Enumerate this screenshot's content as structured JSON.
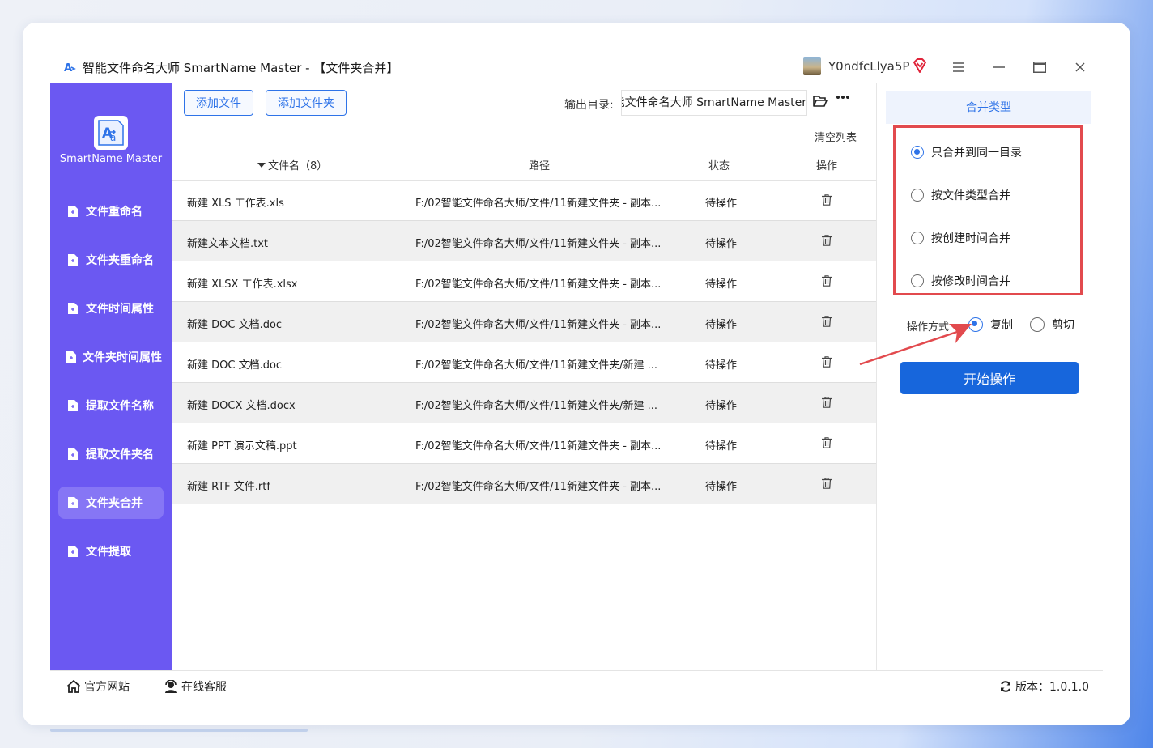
{
  "window": {
    "title": "智能文件命名大师 SmartName Master - 【文件夹合并】",
    "user_name": "Y0ndfcLlya5P"
  },
  "sidebar": {
    "app_name": "SmartName Master",
    "items": [
      {
        "label": "文件重命名",
        "active": false
      },
      {
        "label": "文件夹重命名",
        "active": false
      },
      {
        "label": "文件时间属性",
        "active": false
      },
      {
        "label": "文件夹时间属性",
        "active": false
      },
      {
        "label": "提取文件名称",
        "active": false
      },
      {
        "label": "提取文件夹名",
        "active": false
      },
      {
        "label": "文件夹合并",
        "active": true
      },
      {
        "label": "文件提取",
        "active": false
      }
    ]
  },
  "toolbar": {
    "add_file": "添加文件",
    "add_folder": "添加文件夹",
    "output_label": "输出目录:",
    "output_value": "能文件命名大师 SmartName Master",
    "clear_list": "清空列表"
  },
  "table": {
    "headers": {
      "name": "文件名（8）",
      "path": "路径",
      "status": "状态",
      "action": "操作"
    },
    "rows": [
      {
        "name": "新建 XLS 工作表.xls",
        "path": "F:/02智能文件命名大师/文件/11新建文件夹 - 副本...",
        "status": "待操作"
      },
      {
        "name": "新建文本文档.txt",
        "path": "F:/02智能文件命名大师/文件/11新建文件夹 - 副本...",
        "status": "待操作"
      },
      {
        "name": "新建 XLSX 工作表.xlsx",
        "path": "F:/02智能文件命名大师/文件/11新建文件夹 - 副本...",
        "status": "待操作"
      },
      {
        "name": "新建 DOC 文档.doc",
        "path": "F:/02智能文件命名大师/文件/11新建文件夹 - 副本...",
        "status": "待操作"
      },
      {
        "name": "新建 DOC 文档.doc",
        "path": "F:/02智能文件命名大师/文件/11新建文件夹/新建 ...",
        "status": "待操作"
      },
      {
        "name": "新建 DOCX 文档.docx",
        "path": "F:/02智能文件命名大师/文件/11新建文件夹/新建 ...",
        "status": "待操作"
      },
      {
        "name": "新建 PPT 演示文稿.ppt",
        "path": "F:/02智能文件命名大师/文件/11新建文件夹 - 副本...",
        "status": "待操作"
      },
      {
        "name": "新建 RTF 文件.rtf",
        "path": "F:/02智能文件命名大师/文件/11新建文件夹 - 副本...",
        "status": "待操作"
      }
    ]
  },
  "merge_panel": {
    "header": "合并类型",
    "options": [
      {
        "label": "只合并到同一目录",
        "selected": true
      },
      {
        "label": "按文件类型合并",
        "selected": false
      },
      {
        "label": "按创建时间合并",
        "selected": false
      },
      {
        "label": "按修改时间合并",
        "selected": false
      }
    ],
    "op_label": "操作方式",
    "op_modes": [
      {
        "label": "复制",
        "selected": true
      },
      {
        "label": "剪切",
        "selected": false
      }
    ],
    "start_button": "开始操作"
  },
  "footer": {
    "website": "官方网站",
    "support": "在线客服",
    "version": "版本：1.0.1.0"
  },
  "colors": {
    "sidebar": "#6b58f2",
    "accent": "#2e73e8",
    "start_button": "#1766dc",
    "highlight": "#e24a4e"
  }
}
